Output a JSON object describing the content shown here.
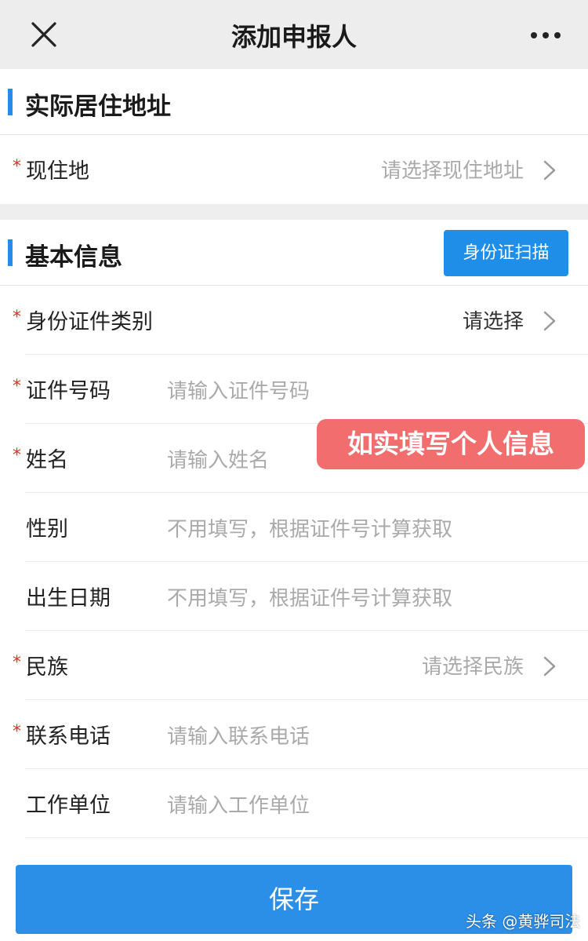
{
  "header": {
    "title": "添加申报人",
    "close_icon": "close-icon",
    "more_icon": "more-icon"
  },
  "section_address": {
    "title": "实际居住地址",
    "rows": [
      {
        "label": "现住地",
        "required": "*",
        "value": "请选择现住地址"
      }
    ]
  },
  "section_basic": {
    "title": "基本信息",
    "scan_label": "身份证扫描",
    "id_type": {
      "label": "身份证件类别",
      "required": "*",
      "value": "请选择"
    },
    "id_number": {
      "label": "证件号码",
      "required": "*",
      "placeholder": "请输入证件号码"
    },
    "name": {
      "label": "姓名",
      "required": "*",
      "placeholder": "请输入姓名"
    },
    "gender": {
      "label": "性别",
      "placeholder": "不用填写，根据证件号计算获取"
    },
    "birth": {
      "label": "出生日期",
      "placeholder": "不用填写，根据证件号计算获取"
    },
    "ethnicity": {
      "label": "民族",
      "required": "*",
      "value": "请选择民族"
    },
    "phone": {
      "label": "联系电话",
      "required": "*",
      "placeholder": "请输入联系电话"
    },
    "employer": {
      "label": "工作单位",
      "placeholder": "请输入工作单位"
    }
  },
  "overlay_note": "如实填写个人信息",
  "footer": {
    "save_label": "保存"
  },
  "watermark": "头条 @黄骅司法",
  "colors": {
    "accent": "#2a8be6",
    "required": "#e0302a",
    "overlay": "#f26d6d"
  }
}
